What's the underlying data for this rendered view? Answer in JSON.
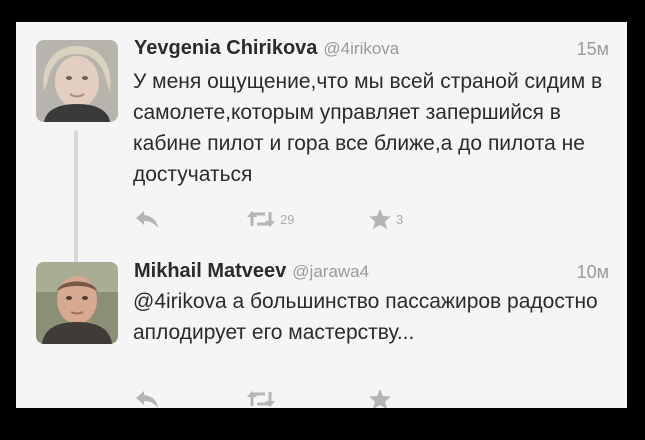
{
  "tweets": [
    {
      "name": "Yevgenia Chirikova",
      "handle": "@4irikova",
      "time": "15м",
      "text": "У меня ощущение,что мы всей страной сидим в самолете,которым управляет запершийся в кабине пилот и гора все ближе,а до пилота не достучаться",
      "retweets": "29",
      "favorites": "3"
    },
    {
      "name": "Mikhail Matveev",
      "handle": "@jarawa4",
      "time": "10м",
      "text": "@4irikova а большинство пассажиров радостно аплодирует его мастерству...",
      "retweets": "",
      "favorites": ""
    }
  ],
  "icons": {
    "reply": "reply-icon",
    "retweet": "retweet-icon",
    "favorite": "star-icon"
  },
  "colors": {
    "background": "#f5f5f5",
    "text": "#2b2b2b",
    "muted": "#9a9a9a",
    "icon": "#b5b5b5"
  }
}
